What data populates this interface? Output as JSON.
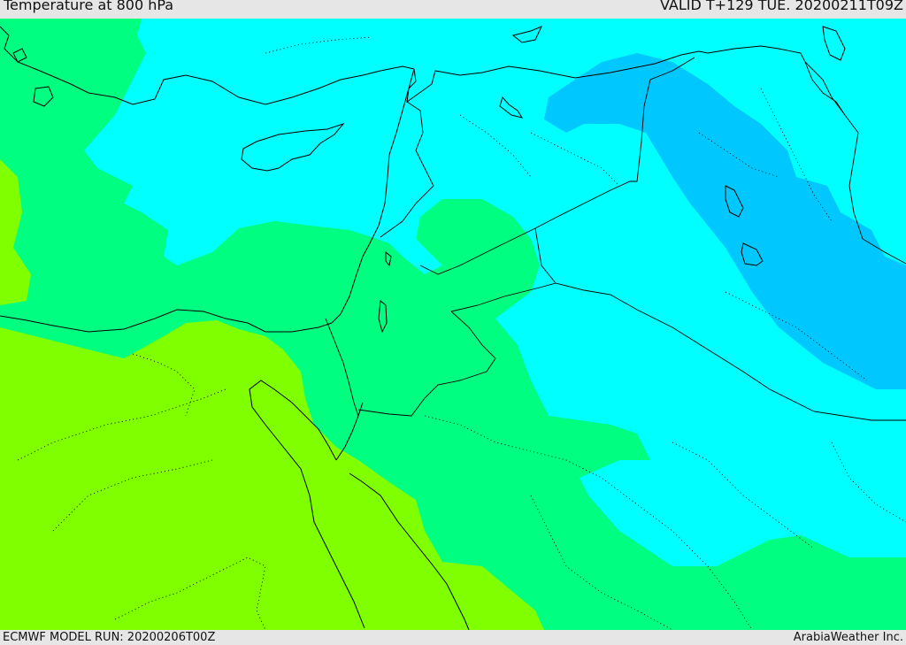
{
  "header": {
    "title": "Temperature at 800 hPa",
    "valid": "VALID T+129 TUE. 20200211T09Z"
  },
  "footer": {
    "model_run": "ECMWF MODEL RUN: 20200206T00Z",
    "credit": "ArabiaWeather Inc."
  },
  "map": {
    "variable": "temperature",
    "level": "800 hPa",
    "color_bands": {
      "coldest": "#00c8ff",
      "cold": "#00ffff",
      "mild": "#00ff80",
      "warm": "#80ff00"
    },
    "line_color": "#000000"
  }
}
